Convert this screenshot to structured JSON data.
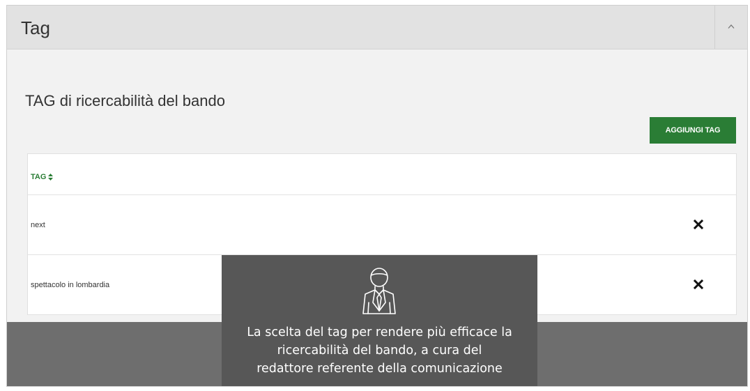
{
  "panel": {
    "title": "Tag",
    "collapse_icon": "chevron-up-icon"
  },
  "section": {
    "title": "TAG di ricercabilità del bando",
    "add_button_label": "AGGIUNGI TAG"
  },
  "table": {
    "column_header": "TAG",
    "sort_icon": "sort-icon",
    "rows": [
      {
        "tag": "next",
        "action_icon": "close-icon"
      },
      {
        "tag": "spettacolo in lombardia",
        "action_icon": "close-icon"
      }
    ]
  },
  "tooltip": {
    "icon": "person-icon",
    "lines": [
      "La scelta del tag per rendere più efficace la",
      "ricercabilità del bando, a cura del",
      "redattore referente della comunicazione"
    ]
  },
  "colors": {
    "accent": "#2a7d35",
    "header_bg": "#e2e2e2",
    "panel_bg": "#f2f2f2",
    "tooltip_bg": "#575757",
    "band_bg": "#6e6e6e"
  }
}
